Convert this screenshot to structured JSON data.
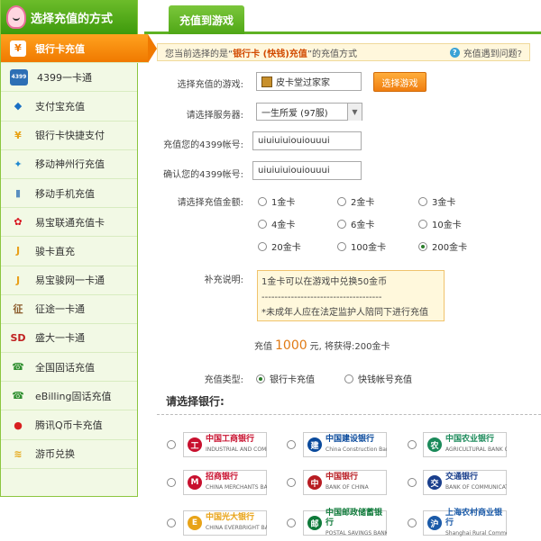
{
  "sidebar": {
    "title": "选择充值的方式",
    "items": [
      {
        "label": "银行卡充值",
        "icon": "yuan-icon",
        "glyph": "¥",
        "color": "#f07900",
        "active": true
      },
      {
        "label": "4399一卡通",
        "icon": "card-icon",
        "glyph": "4399",
        "color": "#2d6fb5"
      },
      {
        "label": "支付宝充值",
        "icon": "shield-icon",
        "glyph": "◆",
        "color": "#1a6fc4"
      },
      {
        "label": "银行卡快捷支付",
        "icon": "yuan-icon",
        "glyph": "¥",
        "color": "#e8a317"
      },
      {
        "label": "移动神州行充值",
        "icon": "mobile-brand-icon",
        "glyph": "✦",
        "color": "#1f88d0"
      },
      {
        "label": "移动手机充值",
        "icon": "phone-icon",
        "glyph": "▮",
        "color": "#5a8fc0"
      },
      {
        "label": "易宝联通充值卡",
        "icon": "unicom-icon",
        "glyph": "✿",
        "color": "#d8141e"
      },
      {
        "label": "骏卡直充",
        "icon": "j-icon",
        "glyph": "J",
        "color": "#e9a01a"
      },
      {
        "label": "易宝骏网一卡通",
        "icon": "j-icon",
        "glyph": "J",
        "color": "#e9a01a"
      },
      {
        "label": "征途一卡通",
        "icon": "zhengtu-icon",
        "glyph": "征",
        "color": "#8a5a2a"
      },
      {
        "label": "盛大一卡通",
        "icon": "shanda-icon",
        "glyph": "SD",
        "color": "#c02020"
      },
      {
        "label": "全国固话充值",
        "icon": "telephone-icon",
        "glyph": "☎",
        "color": "#2f8f2f"
      },
      {
        "label": "eBilling固话充值",
        "icon": "telephone-icon",
        "glyph": "☎",
        "color": "#2f8f2f"
      },
      {
        "label": "腾讯Q币卡充值",
        "icon": "penguin-icon",
        "glyph": "●",
        "color": "#d82020"
      },
      {
        "label": "游币兑换",
        "icon": "coins-icon",
        "glyph": "≋",
        "color": "#e6a817"
      }
    ]
  },
  "tab": {
    "label": "充值到游戏"
  },
  "notice": {
    "prefix": "您当前选择的是“",
    "method": "银行卡 (快钱)充值",
    "suffix": "”的充值方式",
    "help": "充值遇到问题?"
  },
  "form": {
    "game_label": "选择充值的游戏:",
    "game_value": "皮卡堂过家家",
    "select_game_button": "选择游戏",
    "server_label": "请选择服务器:",
    "server_value": "一生所爱 (97服)",
    "account_label": "充值您的4399帐号:",
    "account_value": "uiuiuiuiouiouuui",
    "confirm_label": "确认您的4399帐号:",
    "confirm_value": "uiuiuiuiouiouuui",
    "amount_label": "请选择充值金额:",
    "amounts": [
      "1金卡",
      "2金卡",
      "3金卡",
      "4金卡",
      "6金卡",
      "10金卡",
      "20金卡",
      "100金卡",
      "200金卡"
    ],
    "selected_amount": "200金卡",
    "extra_label": "补充说明:",
    "extra_lines": [
      "1金卡可以在游戏中兑换50金币",
      "-------------------------------------",
      "*未成年人应在法定监护人陪同下进行充值"
    ],
    "charge_prefix": "充值",
    "charge_amount": "1000",
    "charge_middle": "元, 将获得:",
    "charge_result": "200金卡",
    "type_label": "充值类型:",
    "types": [
      "银行卡充值",
      "快钱帐号充值"
    ],
    "selected_type": "银行卡充值"
  },
  "banks": {
    "title": "请选择银行:",
    "list": [
      {
        "name": "中国工商银行",
        "en": "INDUSTRIAL AND COMMERCIAL BANK OF CHINA",
        "icon": "icbc-logo-icon",
        "color": "#c8102e",
        "glyph": "工"
      },
      {
        "name": "中国建设银行",
        "en": "China Construction Bank",
        "icon": "ccb-logo-icon",
        "color": "#0a4a9c",
        "glyph": "建"
      },
      {
        "name": "中国农业银行",
        "en": "AGRICULTURAL BANK OF CHINA",
        "icon": "abc-logo-icon",
        "color": "#1b8a5a",
        "glyph": "农"
      },
      {
        "name": "招商银行",
        "en": "CHINA MERCHANTS BANK",
        "icon": "cmb-logo-icon",
        "color": "#c8102e",
        "glyph": "M"
      },
      {
        "name": "中国银行",
        "en": "BANK OF CHINA",
        "icon": "boc-logo-icon",
        "color": "#b81c22",
        "glyph": "中"
      },
      {
        "name": "交通银行",
        "en": "BANK OF COMMUNICATIONS",
        "icon": "bocom-logo-icon",
        "color": "#1a3f8c",
        "glyph": "交"
      },
      {
        "name": "中国光大银行",
        "en": "CHINA EVERBRIGHT BANK",
        "icon": "ceb-logo-icon",
        "color": "#e8a317",
        "glyph": "E"
      },
      {
        "name": "中国邮政储蓄银行",
        "en": "POSTAL SAVINGS BANK OF CHINA",
        "icon": "psbc-logo-icon",
        "color": "#0f7a3a",
        "glyph": "邮"
      },
      {
        "name": "上海农村商业银行",
        "en": "Shanghai Rural Commercial Bank",
        "icon": "srcb-logo-icon",
        "color": "#1a5aa8",
        "glyph": "沪"
      }
    ]
  }
}
